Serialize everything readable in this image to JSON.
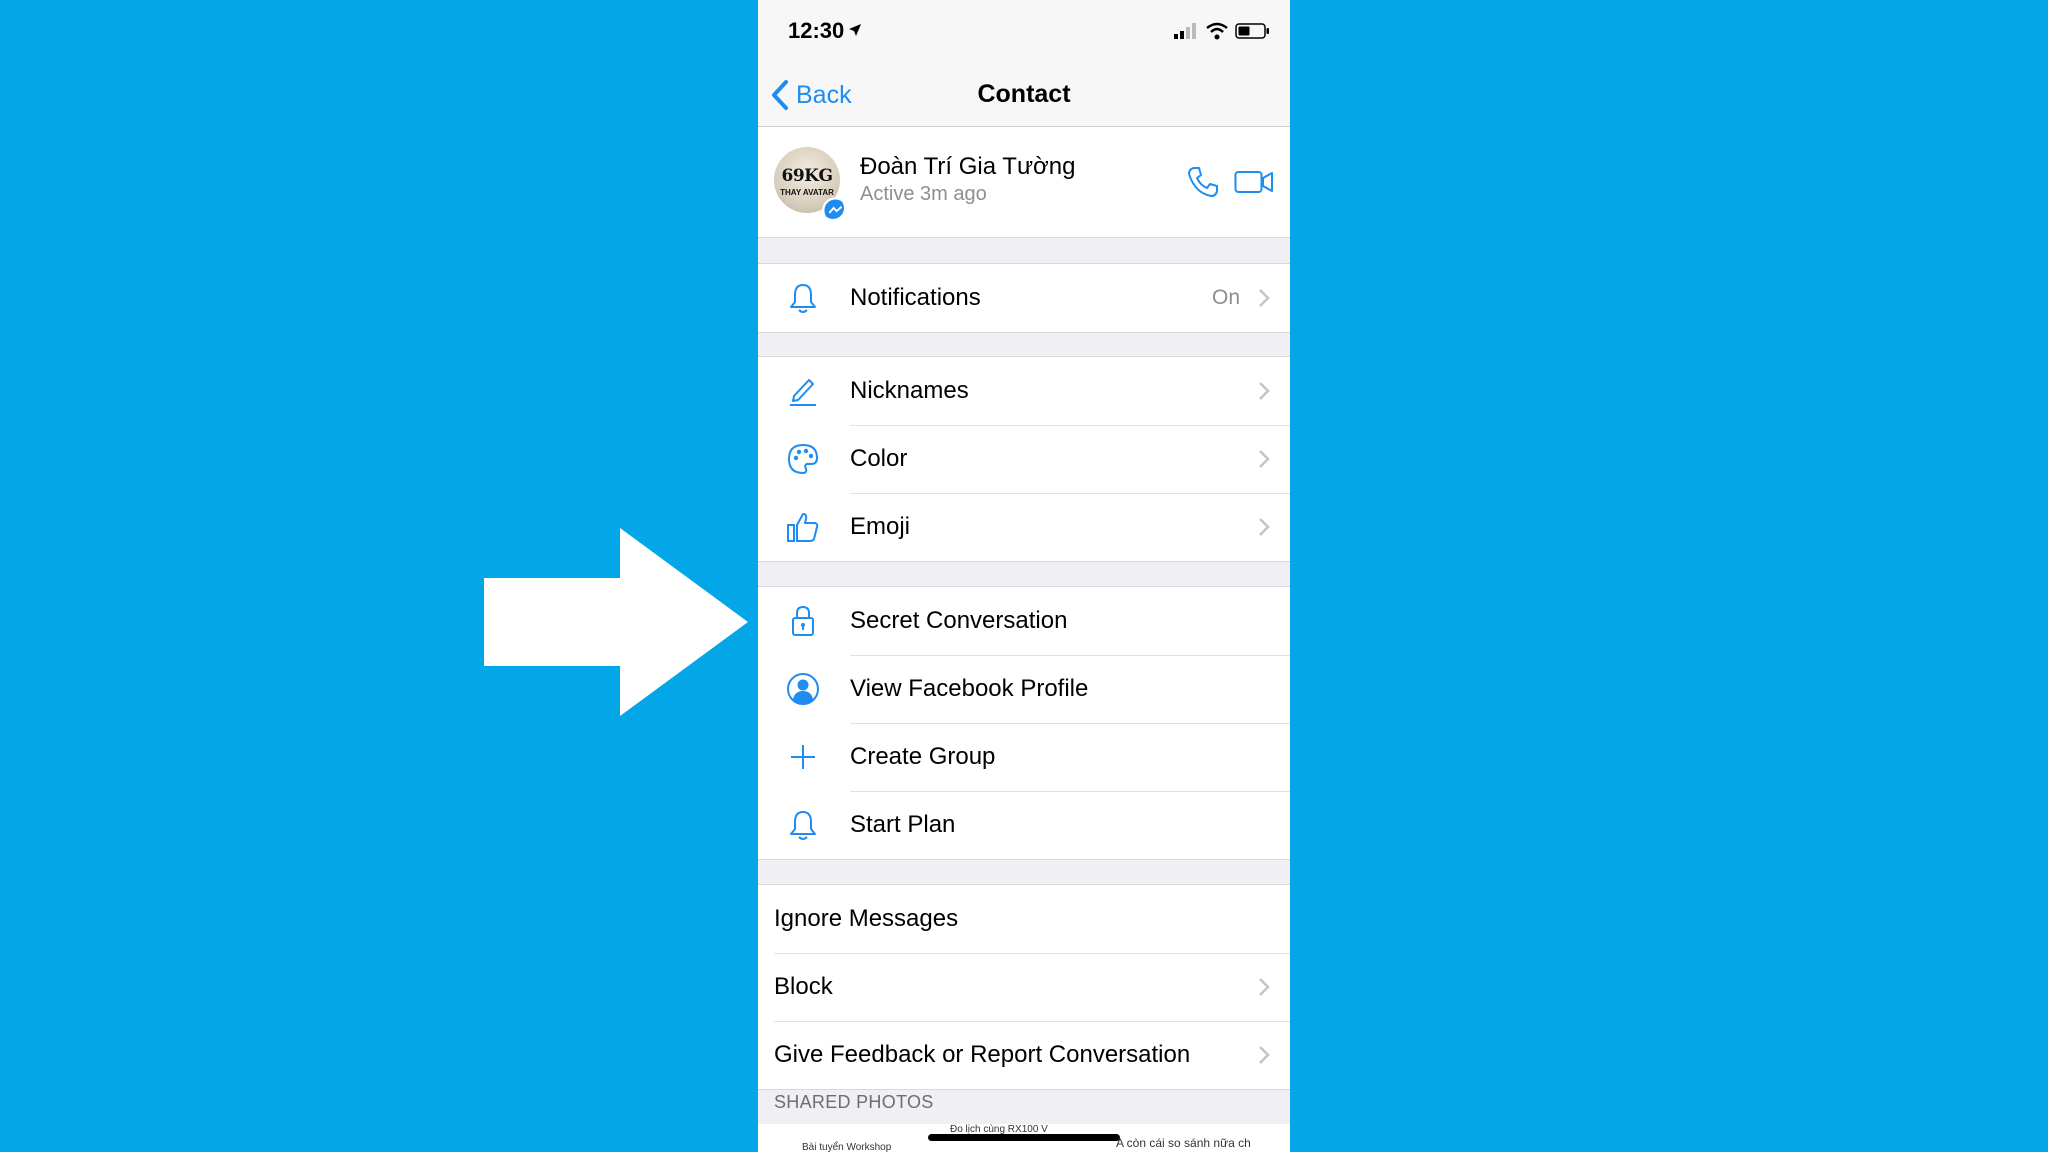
{
  "status_bar": {
    "time": "12:30"
  },
  "nav": {
    "back_label": "Back",
    "title": "Contact"
  },
  "contact": {
    "name": "Đoàn Trí Gia Tường",
    "status": "Active 3m ago",
    "avatar_text_top": "69KG",
    "avatar_text_bottom": "THAY AVATAR"
  },
  "groups": {
    "notifications": {
      "label": "Notifications",
      "value": "On",
      "icon": "bell-icon"
    },
    "customize": [
      {
        "label": "Nicknames",
        "icon": "pencil-icon"
      },
      {
        "label": "Color",
        "icon": "palette-icon"
      },
      {
        "label": "Emoji",
        "icon": "thumbs-up-icon"
      }
    ],
    "actions": [
      {
        "label": "Secret Conversation",
        "icon": "lock-icon"
      },
      {
        "label": "View Facebook Profile",
        "icon": "person-icon"
      },
      {
        "label": "Create Group",
        "icon": "plus-icon"
      },
      {
        "label": "Start Plan",
        "icon": "bell-icon"
      }
    ],
    "privacy": [
      {
        "label": "Ignore Messages"
      },
      {
        "label": "Block"
      },
      {
        "label": "Give Feedback or Report Conversation"
      }
    ]
  },
  "shared_photos": {
    "header": "SHARED PHOTOS",
    "thumb_texts": [
      "Bài tuyển Workshop",
      "Đo lịch cùng RX100 V",
      "A còn cái so sánh nữa ch"
    ]
  },
  "colors": {
    "background": "#03a6e6",
    "accent": "#1f8cf0",
    "arrow": "#ffffff"
  }
}
